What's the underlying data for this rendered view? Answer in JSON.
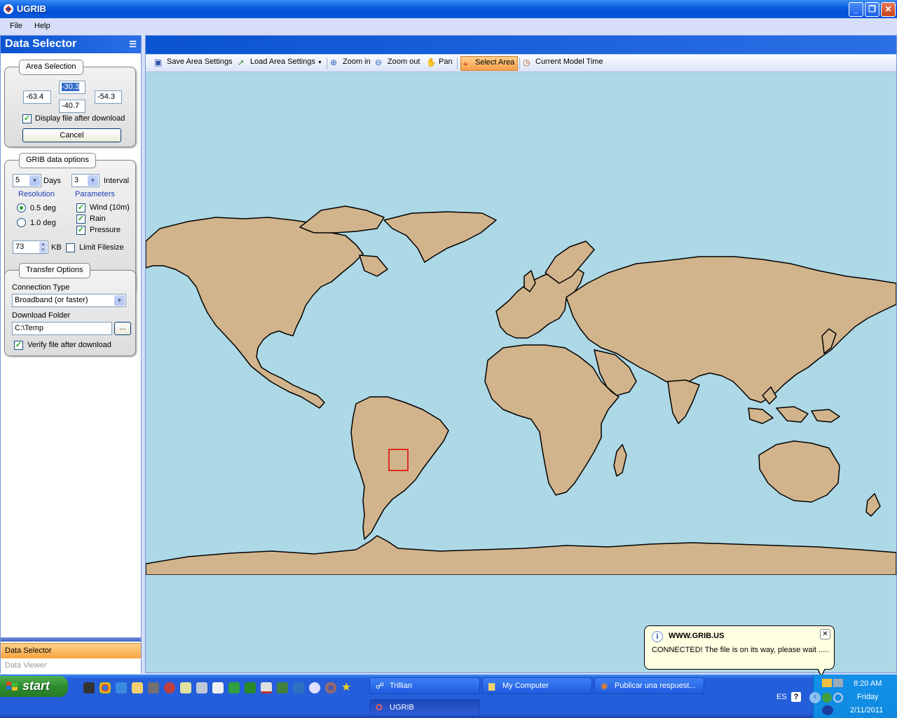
{
  "window": {
    "title": "UGRIB"
  },
  "menu": {
    "file": "File",
    "help": "Help"
  },
  "left_panel": {
    "header": "Data Selector",
    "area_selection": {
      "title": "Area Selection",
      "north": "-30.3",
      "west": "-63.4",
      "east": "-54.3",
      "south": "-40.7",
      "display_after_download_label": "Display file after download",
      "display_after_download_checked": true,
      "cancel_label": "Cancel"
    },
    "grib_options": {
      "title": "GRIB data options",
      "days_value": "5",
      "days_label": "Days",
      "interval_value": "3",
      "interval_label": "Interval",
      "resolution_label": "Resolution",
      "res_05": "0.5 deg",
      "res_10": "1.0 deg",
      "parameters_label": "Parameters",
      "param_wind": "Wind (10m)",
      "param_rain": "Rain",
      "param_pressure": "Pressure",
      "filesize_value": "73",
      "kb_label": "KB",
      "limit_filesize_label": "Limit Filesize"
    },
    "transfer_options": {
      "title": "Transfer Options",
      "connection_type_label": "Connection Type",
      "connection_type_value": "Broadband (or faster)",
      "download_folder_label": "Download Folder",
      "download_folder_value": "C:\\Temp",
      "browse_label": "...",
      "verify_label": "Verify file after download"
    },
    "nav": {
      "data_selector": "Data Selector",
      "data_viewer": "Data Viewer"
    }
  },
  "toolbar": {
    "save_area": "Save Area Settings",
    "load_area": "Load Area Settings",
    "zoom_in": "Zoom in",
    "zoom_out": "Zoom out",
    "pan": "Pan",
    "select_area": "Select Area",
    "current_model_time": "Current Model Time"
  },
  "colors": {
    "ocean": "#add8e6",
    "land": "#d2b48c",
    "selection": "#e00000"
  },
  "balloon": {
    "title": "WWW.GRIB.US",
    "message": "CONNECTED!  The file is on its way, please wait ....."
  },
  "taskbar": {
    "start": "start",
    "tasks": {
      "trillian": "Trillian",
      "my_computer": "My Computer",
      "firefox": "Publicar una respuest...",
      "ugrib": "UGRIB"
    },
    "tray": {
      "lang": "ES",
      "time": "8:20 AM",
      "day": "Friday",
      "date": "2/11/2011"
    }
  }
}
